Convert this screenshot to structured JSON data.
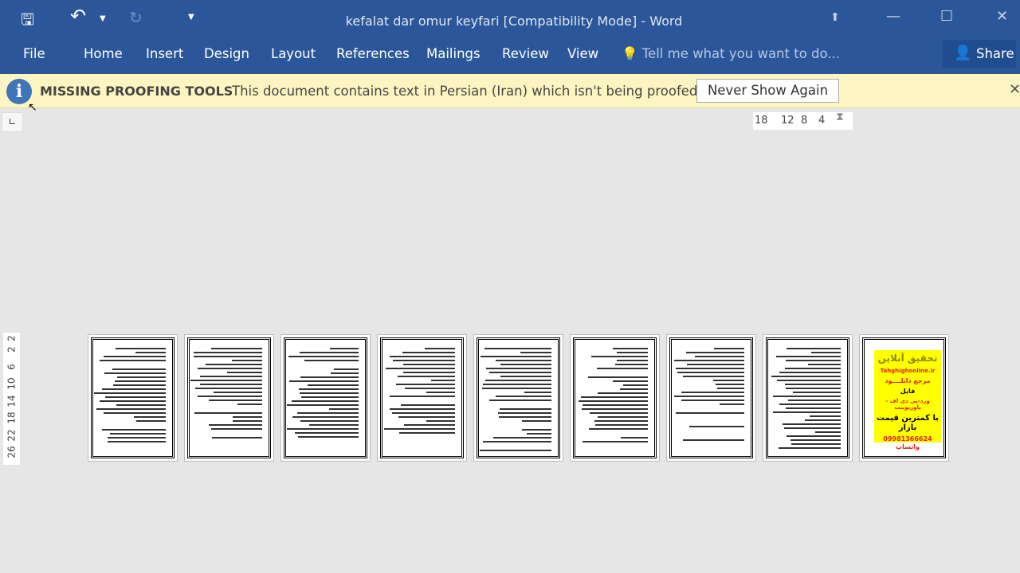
{
  "window": {
    "title": "kefalat dar omur keyfari [Compatibility Mode] - Word"
  },
  "qat": {
    "save_icon": "save-icon",
    "undo_icon": "undo-icon",
    "redo_icon": "redo-icon",
    "customize_icon": "customize-icon"
  },
  "ribbon": {
    "tabs": [
      "File",
      "Home",
      "Insert",
      "Design",
      "Layout",
      "References",
      "Mailings",
      "Review",
      "View"
    ],
    "tell_me": "Tell me what you want to do...",
    "share": "Share"
  },
  "message_bar": {
    "title": "MISSING PROOFING TOOLS",
    "text": "This document contains text in Persian (Iran) which isn't being proofed.",
    "button": "Never Show Again"
  },
  "ruler": {
    "horizontal": [
      "18",
      "12",
      "8",
      "4"
    ],
    "vertical": [
      "2",
      "2",
      "6",
      "10",
      "14",
      "18",
      "22",
      "26"
    ]
  },
  "ad": {
    "lines": [
      "تحقیق آنلاین",
      "Tahghighonline.ir",
      "مرجع دانلــــود",
      "فایل",
      "ورد-پی دی اف - پاورپوینت",
      "با کمترین قیمت بازار",
      "09981366624 واتساپ"
    ]
  },
  "colors": {
    "title_bar": "#2b579a",
    "message_bar": "#fdf5c1"
  }
}
